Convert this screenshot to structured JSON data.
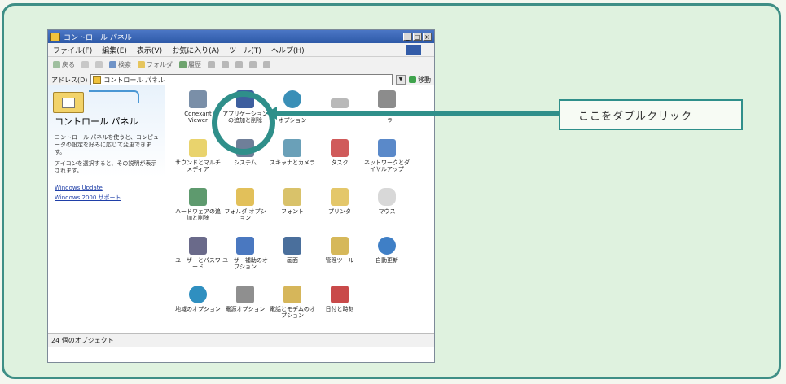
{
  "window": {
    "title": "コントロール パネル",
    "buttons": [
      "_",
      "□",
      "×"
    ]
  },
  "menu": [
    "ファイル(F)",
    "編集(E)",
    "表示(V)",
    "お気に入り(A)",
    "ツール(T)",
    "ヘルプ(H)"
  ],
  "toolbar": {
    "back": "戻る",
    "search": "検索",
    "folders": "フォルダ",
    "history": "履歴"
  },
  "address": {
    "label": "アドレス(D)",
    "value": "コントロール パネル",
    "go": "移動"
  },
  "left_pane": {
    "title": "コントロール パネル",
    "desc1": "コントロール パネルを使うと、コンピュータの設定を好みに応じて変更できます。",
    "desc2": "アイコンを選択すると、その説明が表示されます。",
    "link1": "Windows Update",
    "link2": "Windows 2000 サポート"
  },
  "icons": [
    "Conexant Viewer",
    "アプリケーションの追加と削除",
    "インターネット オプション",
    "キーボード",
    "ゲーム コントローラ",
    "サウンドとマルチメディア",
    "システム",
    "スキャナとカメラ",
    "タスク",
    "ネットワークとダイヤルアップ",
    "ハードウェアの追加と削除",
    "フォルダ オプション",
    "フォント",
    "プリンタ",
    "マウス",
    "ユーザーとパスワード",
    "ユーザー補助のオプション",
    "画面",
    "管理ツール",
    "自動更新",
    "地域のオプション",
    "電源オプション",
    "電話とモデムのオプション",
    "日付と時刻"
  ],
  "status": "24 個のオブジェクト",
  "callout": "ここをダブルクリック",
  "colors": {
    "accent": "#2f8f8a",
    "frame": "#3f8f86",
    "panel_bg": "#dff2df"
  }
}
